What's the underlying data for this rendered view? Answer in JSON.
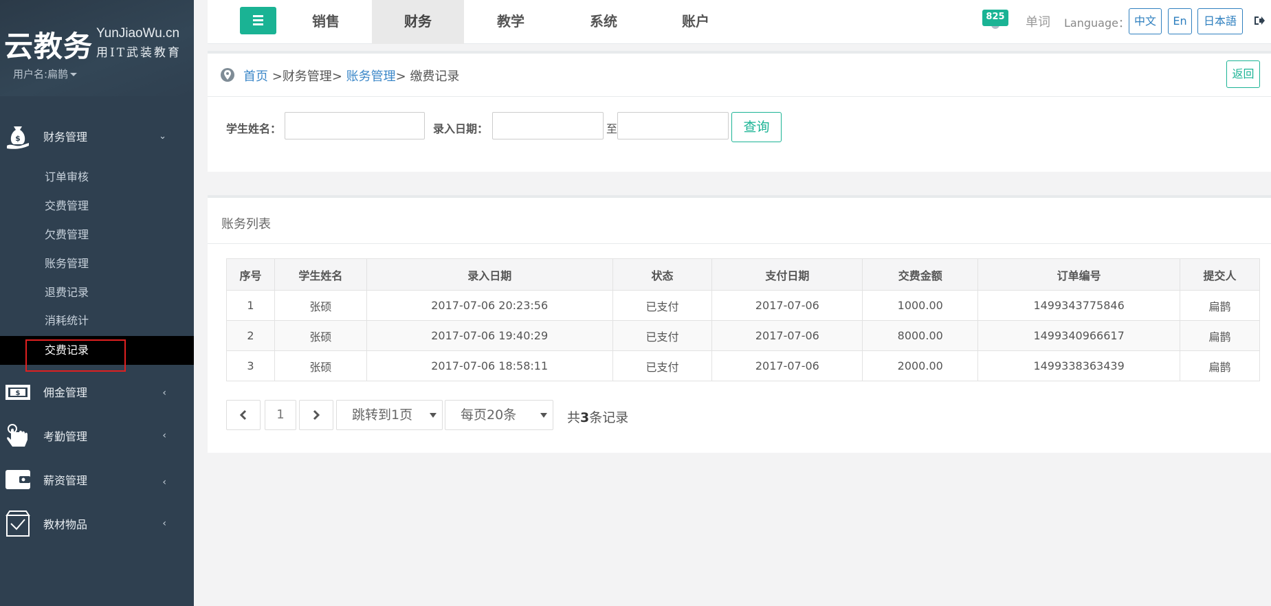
{
  "brand": {
    "logo_main": "云教务",
    "logo_en": "YunJiaoWu.cn",
    "logo_tag": "用IT武装教育"
  },
  "user": {
    "label": "用户名:扁鹊"
  },
  "sidebar": {
    "sections": [
      {
        "label": "财务管理",
        "icon": "money-bag-icon",
        "expanded": true
      },
      {
        "label": "佣金管理",
        "icon": "dollar-bill-icon"
      },
      {
        "label": "考勤管理",
        "icon": "hand-pointer-icon"
      },
      {
        "label": "薪资管理",
        "icon": "wallet-icon"
      },
      {
        "label": "教材物品",
        "icon": "box-icon"
      }
    ],
    "sub_items": [
      "订单审核",
      "交费管理",
      "欠费管理",
      "账务管理",
      "退费记录",
      "消耗统计",
      "交费记录"
    ],
    "active_sub": "交费记录"
  },
  "topnav": {
    "tabs": [
      "销售",
      "财务",
      "教学",
      "系统",
      "账户"
    ],
    "active_tab": "财务",
    "notification_count": "825",
    "word_link": "单词",
    "language_label": "Language：",
    "languages": [
      "中文",
      "En",
      "日本語"
    ]
  },
  "breadcrumb": {
    "home": "首页",
    "sep1": " >",
    "level1": "财务管理",
    "sep2": "> ",
    "level2": "账务管理",
    "sep3": "> ",
    "current": "缴费记录"
  },
  "back_label": "返回",
  "search": {
    "name_label": "学生姓名：",
    "name_value": "",
    "date_label": "录入日期：",
    "date_from": "",
    "to_label": "至",
    "date_to": "",
    "query_label": "查询"
  },
  "table": {
    "title": "账务列表",
    "headers": [
      "序号",
      "学生姓名",
      "录入日期",
      "状态",
      "支付日期",
      "交费金额",
      "订单编号",
      "提交人"
    ],
    "rows": [
      [
        "1",
        "张硕",
        "2017-07-06 20:23:56",
        "已支付",
        "2017-07-06",
        "1000.00",
        "1499343775846",
        "扁鹊"
      ],
      [
        "2",
        "张硕",
        "2017-07-06 19:40:29",
        "已支付",
        "2017-07-06",
        "8000.00",
        "1499340966617",
        "扁鹊"
      ],
      [
        "3",
        "张硕",
        "2017-07-06 18:58:11",
        "已支付",
        "2017-07-06",
        "2000.00",
        "1499338363439",
        "扁鹊"
      ]
    ]
  },
  "pager": {
    "current_page": "1",
    "jump_label": "跳转到1页",
    "page_size_label": "每页20条",
    "total_prefix": "共",
    "total_count": "3",
    "total_suffix": "条记录"
  },
  "colors": {
    "sidebar": "#2f4050",
    "accent": "#1ab394",
    "link": "#3b87c8"
  }
}
